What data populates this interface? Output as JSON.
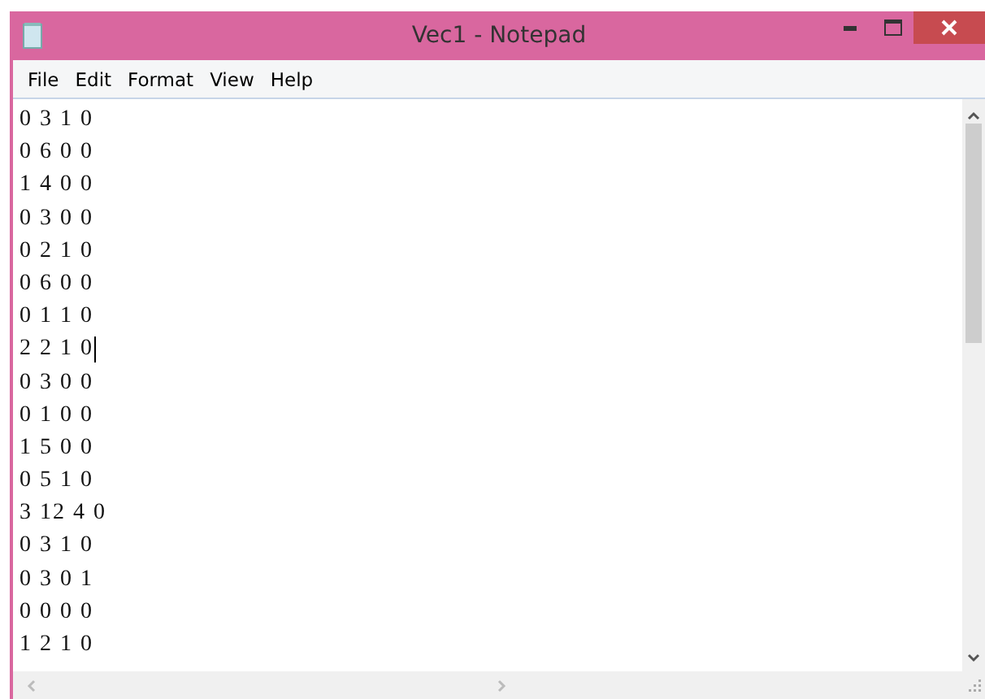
{
  "window": {
    "title": "Vec1 - Notepad"
  },
  "menu": [
    {
      "label": "File"
    },
    {
      "label": "Edit"
    },
    {
      "label": "Format"
    },
    {
      "label": "View"
    },
    {
      "label": "Help"
    }
  ],
  "document": {
    "lines": [
      {
        "text": "0 3 1 0",
        "caret": false
      },
      {
        "text": "0 6 0 0",
        "caret": false
      },
      {
        "text": "1 4 0 0",
        "caret": false
      },
      {
        "text": "0 3 0 0",
        "caret": false
      },
      {
        "text": "0 2 1 0",
        "caret": false
      },
      {
        "text": "0 6 0 0",
        "caret": false
      },
      {
        "text": "0 1 1 0",
        "caret": false
      },
      {
        "text": "2 2 1 0",
        "caret": true
      },
      {
        "text": "0 3 0 0",
        "caret": false
      },
      {
        "text": "0 1 0 0",
        "caret": false
      },
      {
        "text": "1 5 0 0",
        "caret": false
      },
      {
        "text": "0 5 1 0",
        "caret": false
      },
      {
        "text": "3 12 4 0",
        "caret": false
      },
      {
        "text": "0 3 1 0",
        "caret": false
      },
      {
        "text": "0 3 0 1",
        "caret": false
      },
      {
        "text": "0 0 0 0",
        "caret": false
      },
      {
        "text": "1 2 1 0",
        "caret": false
      }
    ]
  }
}
